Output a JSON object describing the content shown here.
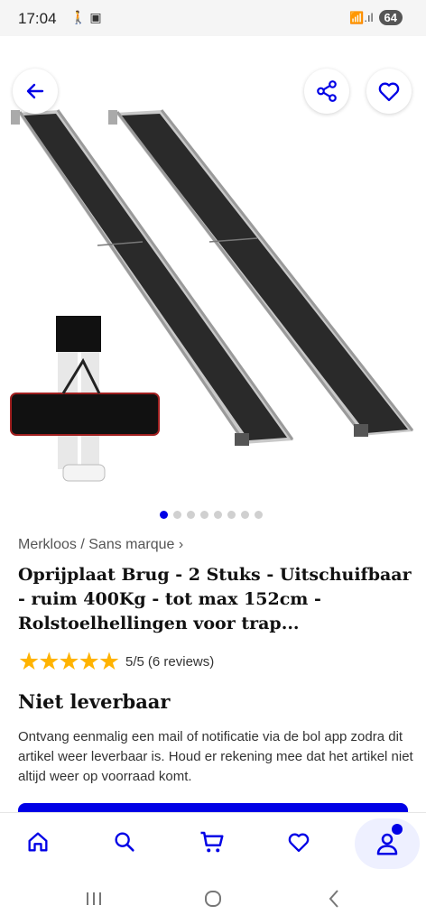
{
  "status_bar": {
    "time": "17:04",
    "left_icons": "🚶 ▣",
    "signal": "📶.ıl",
    "battery": "64"
  },
  "gallery": {
    "dots_count": 8,
    "active_index": 0
  },
  "product": {
    "brand": "Merkloos / Sans marque",
    "title": "Oprijplaat Brug - 2 Stuks - Uitschuifbaar - ruim 400Kg - tot max 152cm - Rolstoelhellingen voor trap...",
    "stars": "★★★★★",
    "rating_score": "5/5",
    "rating_count": "(6 reviews)",
    "availability": "Niet leverbaar",
    "notice": "Ontvang eenmalig een mail of notificatie via de bol app zodra dit artikel weer leverbaar is. Houd er rekening mee dat het artikel niet altijd weer op voorraad komt."
  },
  "icons": {
    "back": "arrow-left-icon",
    "share": "share-icon",
    "favorite": "heart-icon",
    "home": "home-icon",
    "search": "search-icon",
    "cart": "cart-icon",
    "wishlist": "heart-icon",
    "account": "user-icon"
  },
  "colors": {
    "accent": "#0000e6",
    "star": "#ffb300",
    "text": "#1f1f1f"
  }
}
